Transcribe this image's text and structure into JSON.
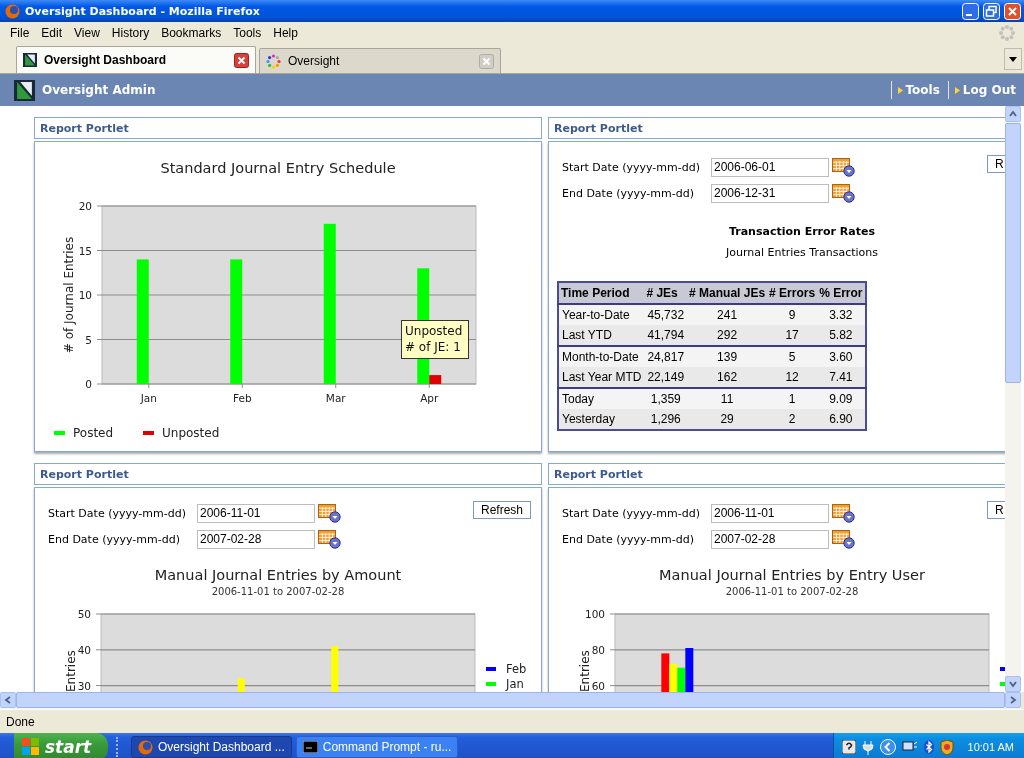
{
  "window": {
    "title": "Oversight Dashboard - Mozilla Firefox"
  },
  "menu": [
    "File",
    "Edit",
    "View",
    "History",
    "Bookmarks",
    "Tools",
    "Help"
  ],
  "tabs": [
    {
      "label": "Oversight Dashboard",
      "selected": true
    },
    {
      "label": "Oversight",
      "selected": false
    }
  ],
  "app_header": {
    "title": "Oversight Admin",
    "links": [
      "Tools",
      "Log Out"
    ]
  },
  "portlets": [
    {
      "header": "Report Portlet",
      "chart_data": {
        "type": "bar",
        "title": "Standard Journal Entry Schedule",
        "ylabel": "# of Journal Entries",
        "categories": [
          "Jan",
          "Feb",
          "Mar",
          "Apr"
        ],
        "series": [
          {
            "name": "Posted",
            "color": "#00ff00",
            "values": [
              14,
              14,
              18,
              13
            ]
          },
          {
            "name": "Unposted",
            "color": "#e00000",
            "values": [
              null,
              null,
              null,
              1
            ]
          }
        ],
        "ylim": [
          0,
          20
        ],
        "yticks": [
          0,
          5,
          10,
          15,
          20
        ],
        "grid": true,
        "legend": true
      },
      "tooltip": [
        "Unposted",
        "# of JE: 1"
      ]
    },
    {
      "header": "Report Portlet",
      "form": [
        {
          "label": "Start Date (yyyy-mm-dd)",
          "value": "2006-06-01"
        },
        {
          "label": "End Date (yyyy-mm-dd)",
          "value": "2006-12-31"
        }
      ],
      "button": "R",
      "title": "Transaction Error Rates",
      "subtitle": "Journal Entries Transactions",
      "table": {
        "columns": [
          "Time Period",
          "# JEs",
          "# Manual JEs",
          "# Errors",
          "% Error"
        ],
        "groups": [
          [
            [
              "Year-to-Date",
              "45,732",
              "241",
              "9",
              "3.32"
            ],
            [
              "Last YTD",
              "41,794",
              "292",
              "17",
              "5.82"
            ]
          ],
          [
            [
              "Month-to-Date",
              "24,817",
              "139",
              "5",
              "3.60"
            ],
            [
              "Last Year MTD",
              "22,149",
              "162",
              "12",
              "7.41"
            ]
          ],
          [
            [
              "Today",
              "1,359",
              "11",
              "1",
              "9.09"
            ],
            [
              "Yesterday",
              "1,296",
              "29",
              "2",
              "6.90"
            ]
          ]
        ]
      }
    },
    {
      "header": "Report Portlet",
      "form": [
        {
          "label": "Start Date (yyyy-mm-dd)",
          "value": "2006-11-01"
        },
        {
          "label": "End Date (yyyy-mm-dd)",
          "value": "2007-02-28"
        }
      ],
      "button": "Refresh",
      "chart_data": {
        "type": "bar",
        "title": "Manual Journal Entries by Amount",
        "ylabel": "Entries",
        "series": [
          {
            "color": "#ffff00",
            "values": [
              null,
              32,
              41,
              null
            ]
          }
        ],
        "ylim": [
          0,
          50
        ],
        "yticks": [
          30,
          40,
          50
        ],
        "grid": true
      },
      "chart_subtitle": "2006-11-01 to 2007-02-28",
      "legend": [
        {
          "label": "Feb",
          "color": "#0000ff"
        },
        {
          "label": "Jan",
          "color": "#00ff00"
        }
      ]
    },
    {
      "header": "Report Portlet",
      "form": [
        {
          "label": "Start Date (yyyy-mm-dd)",
          "value": "2006-11-01"
        },
        {
          "label": "End Date (yyyy-mm-dd)",
          "value": "2007-02-28"
        }
      ],
      "button": "R",
      "chart_data": {
        "type": "bar",
        "title": "Manual Journal Entries by Entry User",
        "ylabel": "Entries",
        "series": [
          {
            "color": "#ff0000",
            "values": [
              78,
              null,
              null
            ]
          },
          {
            "color": "#ffff00",
            "values": [
              72,
              null,
              null
            ]
          },
          {
            "color": "#00ff00",
            "values": [
              70,
              null,
              null
            ]
          },
          {
            "color": "#0000ff",
            "values": [
              81,
              null,
              null
            ]
          }
        ],
        "ylim": [
          0,
          100
        ],
        "yticks": [
          60,
          80,
          100
        ],
        "grid": true
      },
      "chart_subtitle": "2006-11-01 to 2007-02-28",
      "legend": [
        {
          "color": "#0000ff"
        },
        {
          "color": "#00ff00"
        }
      ]
    }
  ],
  "status_bar": "Done",
  "taskbar": {
    "start": "start",
    "tasks": [
      {
        "label": "Oversight Dashboard ...",
        "selected": true
      },
      {
        "label": "Command Prompt - ru...",
        "selected": false
      }
    ],
    "clock": "10:01 AM"
  }
}
